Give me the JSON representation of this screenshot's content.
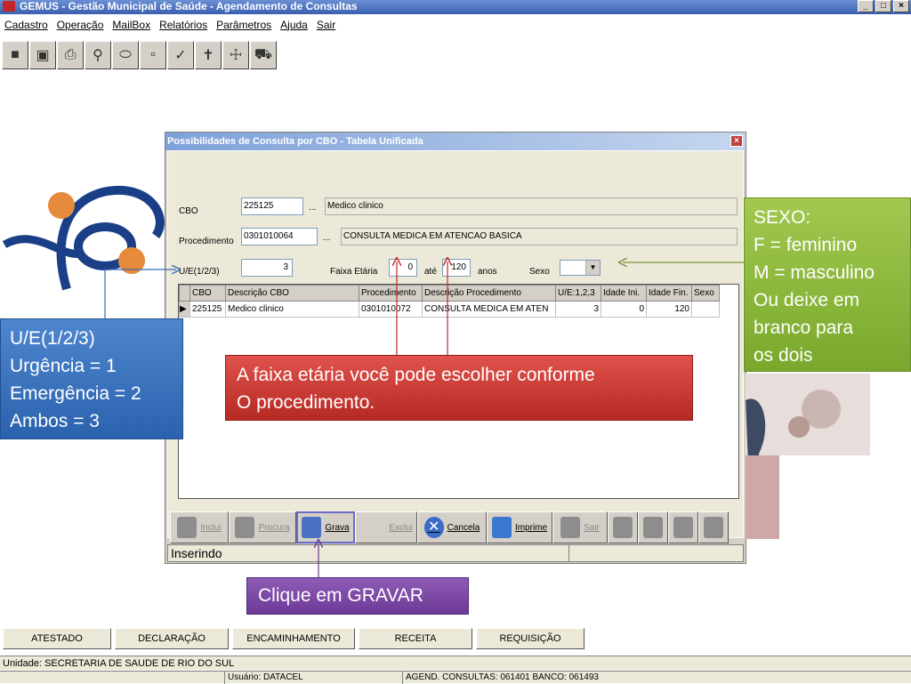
{
  "window": {
    "title": "GEMUS - Gestão Municipal de Saúde - Agendamento de Consultas",
    "controls": [
      "_",
      "□",
      "×"
    ]
  },
  "menu": [
    "Cadastro",
    "Operação",
    "MailBox",
    "Relatórios",
    "Parâmetros",
    "Ajuda",
    "Sair"
  ],
  "toolbar_icons": [
    "people-icon",
    "building-icon",
    "printer-icon",
    "search-icon",
    "pill-icon",
    "clipboard-icon",
    "syringe-icon",
    "cross-icon",
    "medkit-icon",
    "ambulance-icon"
  ],
  "dialog": {
    "title": "Possibilidades de Consulta por CBO - Tabela Unificada",
    "close": "×",
    "cbo_label": "CBO",
    "cbo_value": "225125",
    "cbo_desc": "Medico clinico",
    "proc_label": "Procedimento",
    "proc_value": "0301010064",
    "proc_desc": "CONSULTA MEDICA EM ATENCAO BASICA",
    "dots": "...",
    "ue_label": "U/E(1/2/3)",
    "ue_value": "3",
    "faixa_label": "Faixa Etária",
    "faixa_min": "0",
    "ate_label": "até",
    "faixa_max": "120",
    "anos_label": "anos",
    "sexo_label": "Sexo",
    "sexo_value": "",
    "grid": {
      "headers": [
        "CBO",
        "Descrição CBO",
        "Procedimento",
        "Descrição Procedimento",
        "U/E:1,2,3",
        "Idade Ini.",
        "Idade Fin.",
        "Sexo"
      ],
      "rows": [
        [
          "225125",
          "Medico clinico",
          "0301010072",
          "CONSULTA MEDICA EM ATEN",
          "3",
          "0",
          "120",
          ""
        ]
      ]
    },
    "buttons": {
      "incluir": "Inclui",
      "procura": "Procura",
      "grava": "Grava",
      "exclui": "Exclui",
      "cancela": "Cancela",
      "imprime": "Imprime",
      "sair": "Sair"
    },
    "status": "Inserindo"
  },
  "callouts": {
    "sexo": [
      "SEXO:",
      "F = feminino",
      "M = masculino",
      "Ou deixe em",
      "branco para",
      "os dois"
    ],
    "ue": [
      "U/E(1/2/3)",
      "Urgência = 1",
      "Emergência = 2",
      "Ambos =  3"
    ],
    "faixa": [
      "A faixa etária você pode escolher conforme",
      "O procedimento."
    ],
    "gravar": "Clique em GRAVAR"
  },
  "bottom_buttons": [
    "ATESTADO",
    "DECLARAÇÃO",
    "ENCAMINHAMENTO",
    "RECEITA",
    "REQUISIÇÃO"
  ],
  "status_unit": "Unidade: SECRETARIA DE SAUDE DE RIO DO SUL",
  "status_user": "Usuário: DATACEL",
  "status_agend": "AGEND. CONSULTAS: 061401 BANCO: 061493",
  "colors": {
    "green": "#8ab83c",
    "blue": "#3a72bd",
    "red": "#c73a34",
    "purple": "#7c48a4"
  }
}
